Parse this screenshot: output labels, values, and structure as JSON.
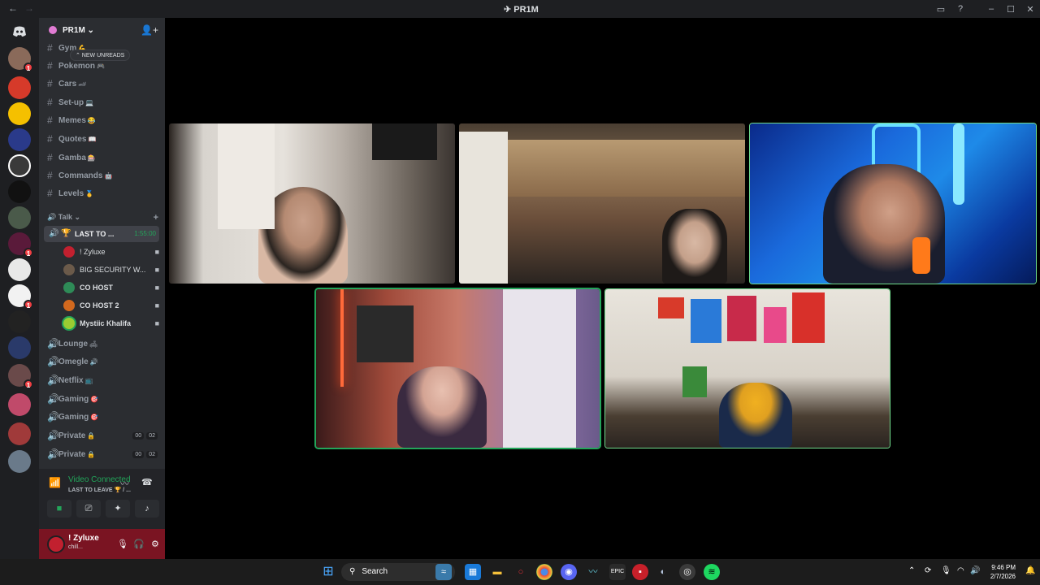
{
  "window": {
    "title": "PR1M",
    "back_icon": "arrow-left-icon",
    "forward_icon": "arrow-right-icon"
  },
  "server": {
    "name": "PR1M ⌄",
    "new_unreads": "⌃ NEW UNREADS"
  },
  "text_channels": [
    {
      "label": "Gym",
      "emoji": "💪"
    },
    {
      "label": "Pokemon",
      "emoji": "🎮"
    },
    {
      "label": "Cars",
      "emoji": "🏎"
    },
    {
      "label": "Set-up",
      "emoji": "💻"
    },
    {
      "label": "Memes",
      "emoji": "😂"
    },
    {
      "label": "Quotes",
      "emoji": "📖"
    },
    {
      "label": "Gamba",
      "emoji": "🎰"
    },
    {
      "label": "Commands",
      "emoji": "🤖"
    },
    {
      "label": "Levels",
      "emoji": "🥇"
    }
  ],
  "voice_category": {
    "label": "🔊 Talk ⌄",
    "add": "+"
  },
  "active_voice": {
    "label": "LAST TO ...",
    "timer": "1:55:00",
    "members": [
      {
        "name": "! Zyluxe",
        "color": "#c2202f"
      },
      {
        "name": "BIG SECURITY W...",
        "color": "#6b5a4a"
      },
      {
        "name": "CO HOST",
        "color": "#2e8b57"
      },
      {
        "name": "CO HOST 2",
        "color": "#d2691e"
      },
      {
        "name": "Mystiic Khalifa",
        "color": "#9acd32"
      }
    ]
  },
  "voice_channels": [
    {
      "label": "Lounge",
      "emoji": "🛋",
      "counts": [
        "",
        ""
      ]
    },
    {
      "label": "Omegle",
      "emoji": "🔊",
      "counts": [
        "",
        ""
      ]
    },
    {
      "label": "Netflix",
      "emoji": "📺",
      "counts": [
        "",
        ""
      ]
    },
    {
      "label": "Gaming",
      "emoji": "🎯",
      "counts": [
        "",
        ""
      ]
    },
    {
      "label": "Gaming",
      "emoji": "🎯",
      "counts": [
        "",
        ""
      ]
    },
    {
      "label": "Private",
      "emoji": "🔒",
      "counts": [
        "00",
        "02"
      ]
    },
    {
      "label": "Private",
      "emoji": "🔒",
      "counts": [
        "00",
        "02"
      ]
    }
  ],
  "voice_panel": {
    "status": "Video Connected",
    "channel": "LAST TO LEAVE 🏆 / ..."
  },
  "user": {
    "name": "! Zyluxe",
    "status": "chill..."
  },
  "taskbar": {
    "search": "Search",
    "time": "9:46 PM",
    "date": "2/7/2026"
  },
  "colors": {
    "speaking": "#23a55a",
    "rail_bg": "#1e1f22",
    "sidebar_bg": "#2b2d31",
    "user_panel": "#7a1422"
  }
}
